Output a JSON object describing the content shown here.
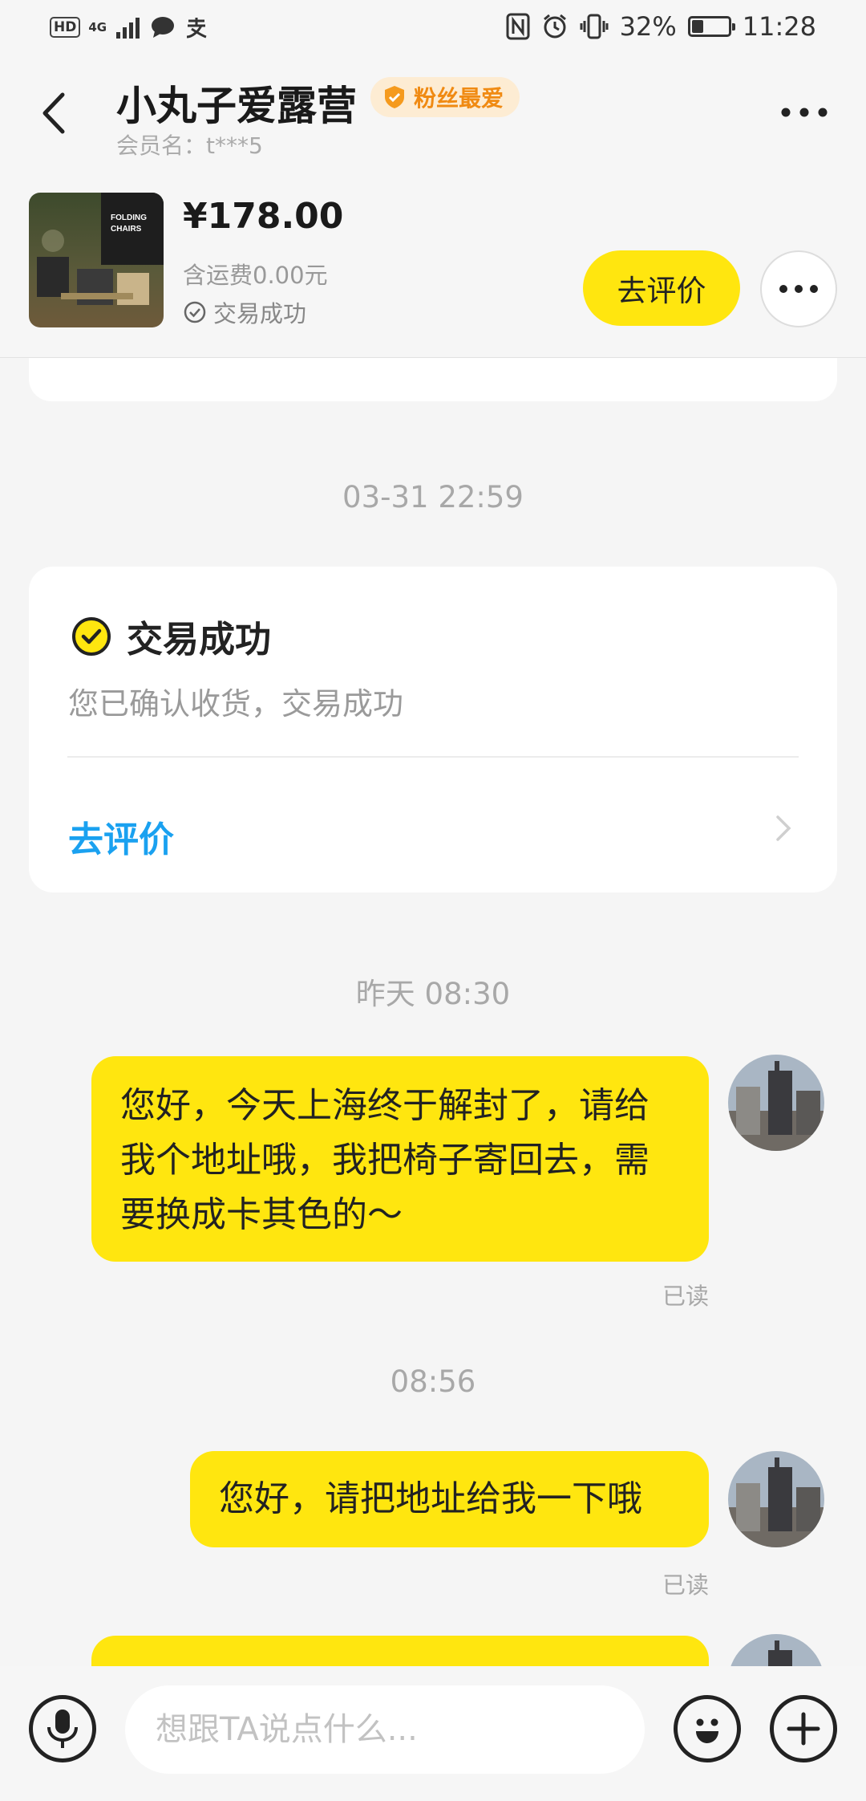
{
  "status_bar": {
    "hd": "HD",
    "network": "4G",
    "battery": "32%",
    "battery_level": 0.32,
    "time": "11:28"
  },
  "header": {
    "title": "小丸子爱露营",
    "badge": "粉丝最爱",
    "member": "会员名：t***5"
  },
  "order": {
    "thumb_text_1": "FOLDING",
    "thumb_text_2": "CHAIRS",
    "price": "¥178.00",
    "shipping": "含运费0.00元",
    "status": "交易成功",
    "review_button": "去评价"
  },
  "chat": {
    "time1": "03-31 22:59",
    "card": {
      "title": "交易成功",
      "subtitle": "您已确认收货，交易成功",
      "link": "去评价"
    },
    "time2": "昨天 08:30",
    "msg1": "您好，今天上海终于解封了，请给我个地址哦，我把椅子寄回去，需要换成卡其色的～",
    "read1": "已读",
    "time3": "08:56",
    "msg2": "您好，请把地址给我一下哦",
    "read2": "已读"
  },
  "input": {
    "placeholder": "想跟TA说点什么..."
  },
  "colors": {
    "accent_yellow": "#ffe60f",
    "link_blue": "#1aa1f0",
    "badge_orange": "#f08a12"
  }
}
